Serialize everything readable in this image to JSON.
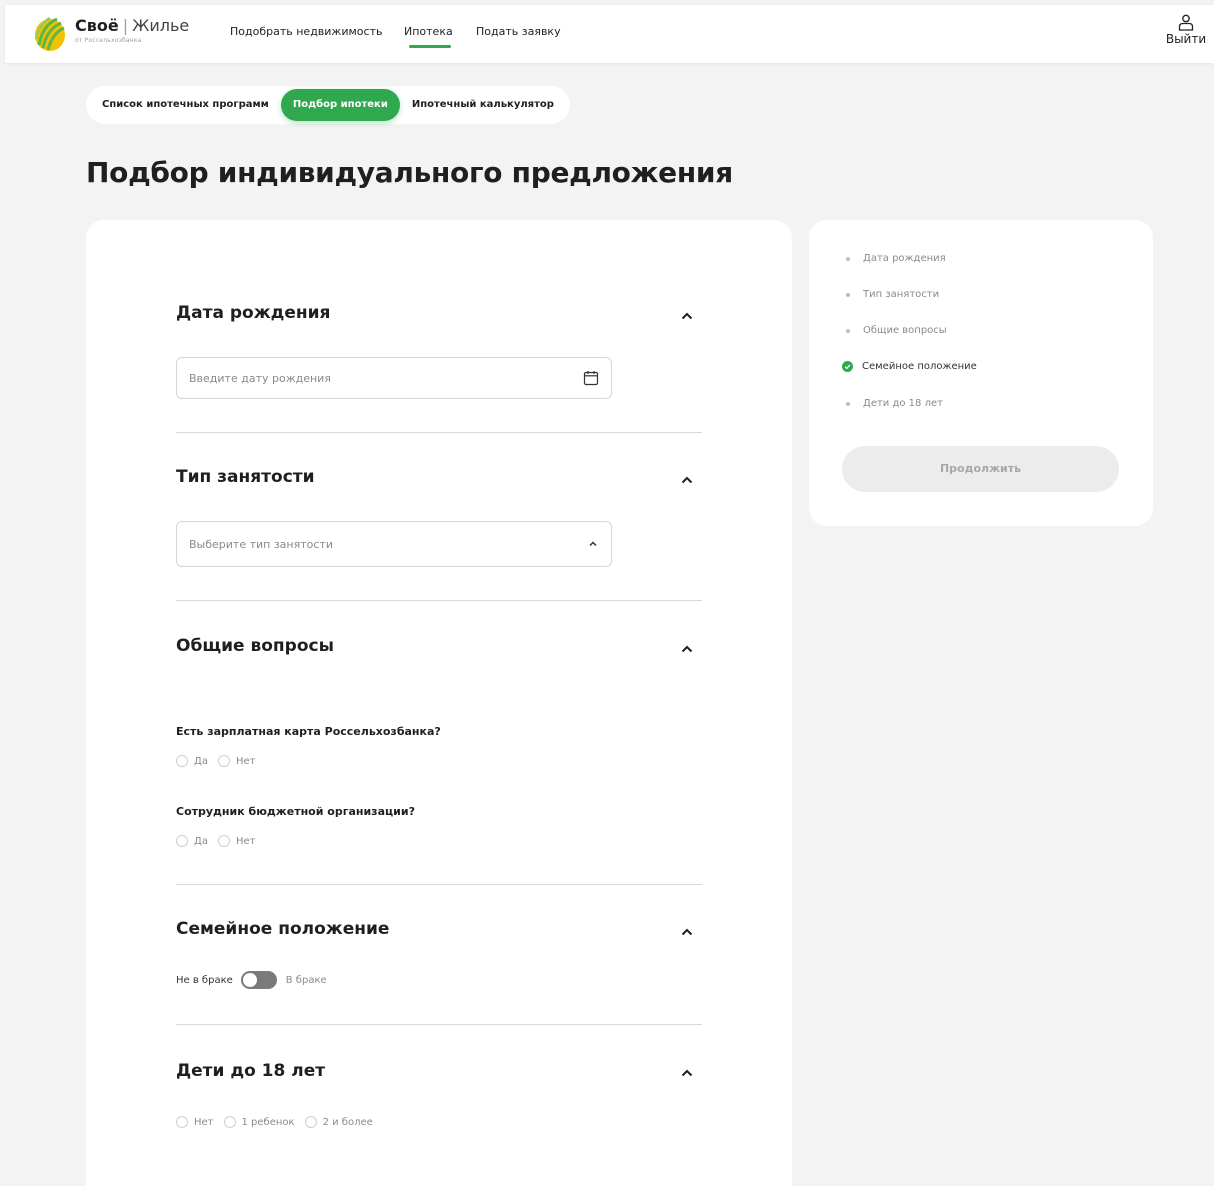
{
  "header": {
    "brand": {
      "name_bold": "Своё",
      "separator": "|",
      "name_light": "Жилье",
      "subtitle": "от Россельхозбанка"
    },
    "nav": [
      {
        "label": "Подобрать недвижимость",
        "active": false
      },
      {
        "label": "Ипотека",
        "active": true
      },
      {
        "label": "Подать заявку",
        "active": false
      }
    ],
    "logout_label": "Выйти",
    "logout_icon": "user-icon"
  },
  "tabs": [
    {
      "label": "Список ипотечных программ",
      "active": false
    },
    {
      "label": "Подбор ипотеки",
      "active": true
    },
    {
      "label": "Ипотечный калькулятор",
      "active": false
    }
  ],
  "page_title": "Подбор индивидуального предложения",
  "form": {
    "birth_date": {
      "title": "Дата рождения",
      "placeholder": "Введите дату рождения",
      "value": "",
      "icon": "calendar-icon"
    },
    "employment": {
      "title": "Тип занятости",
      "placeholder": "Выберите тип занятости",
      "icon": "chevron-up-icon"
    },
    "general": {
      "title": "Общие вопросы",
      "q1": {
        "label": "Есть зарплатная карта Россельхозбанка?",
        "options": [
          "Да",
          "Нет"
        ],
        "selected": null
      },
      "q2": {
        "label": "Сотрудник бюджетной организации?",
        "options": [
          "Да",
          "Нет"
        ],
        "selected": null
      }
    },
    "marital": {
      "title": "Семейное положение",
      "off_label": "Не в браке",
      "on_label": "В браке",
      "checked": false
    },
    "children": {
      "title": "Дети до 18 лет",
      "options": [
        "Нет",
        "1 ребенок",
        "2 и более"
      ],
      "selected": null
    }
  },
  "steps": [
    {
      "label": "Дата рождения",
      "done": false
    },
    {
      "label": "Тип занятости",
      "done": false
    },
    {
      "label": "Общие вопросы",
      "done": false
    },
    {
      "label": "Семейное положение",
      "done": true
    },
    {
      "label": "Дети до 18 лет",
      "done": false
    }
  ],
  "continue_label": "Продолжить",
  "colors": {
    "accent": "#2fa84f",
    "background": "#f3f3f4",
    "card": "#ffffff",
    "toggle_off": "#7a7a7a"
  }
}
